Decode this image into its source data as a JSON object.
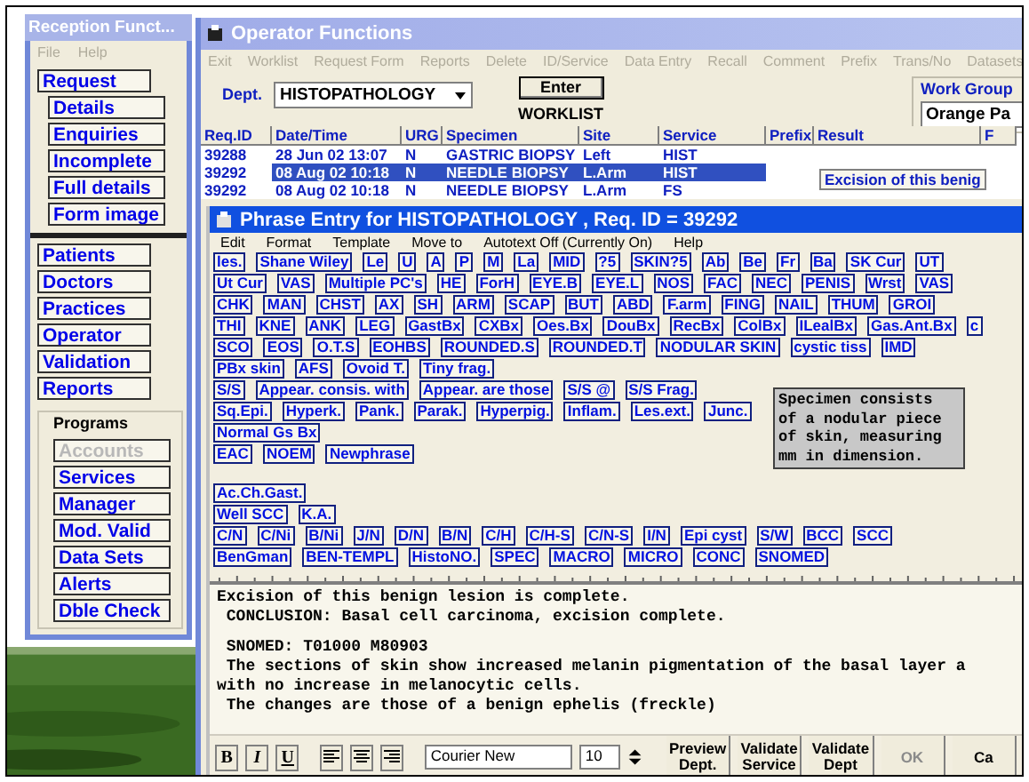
{
  "reception": {
    "title": "Reception Funct...",
    "menu": [
      "File",
      "Help"
    ],
    "nav_groups": [
      {
        "items": [
          {
            "label": "Request",
            "kind": "main"
          },
          {
            "label": "Details",
            "kind": "sub"
          },
          {
            "label": "Enquiries",
            "kind": "sub"
          },
          {
            "label": "Incomplete",
            "kind": "sub"
          },
          {
            "label": "Full details",
            "kind": "sub"
          },
          {
            "label": "Form image",
            "kind": "sub"
          }
        ]
      },
      {
        "items": [
          {
            "label": "Patients",
            "kind": "main"
          },
          {
            "label": "Doctors",
            "kind": "main"
          },
          {
            "label": "Practices",
            "kind": "main"
          },
          {
            "label": "Operator",
            "kind": "main"
          },
          {
            "label": "Validation",
            "kind": "main"
          },
          {
            "label": "Reports",
            "kind": "main"
          }
        ]
      },
      {
        "title": "Programs",
        "items": [
          {
            "label": "Accounts",
            "kind": "sub",
            "disabled": true
          },
          {
            "label": "Services",
            "kind": "sub",
            "disabled": false
          },
          {
            "label": "Manager",
            "kind": "sub",
            "disabled": false
          },
          {
            "label": "Mod. Valid",
            "kind": "sub",
            "disabled": false
          },
          {
            "label": "Data Sets",
            "kind": "sub",
            "disabled": false
          },
          {
            "label": "Alerts",
            "kind": "sub",
            "disabled": false
          },
          {
            "label": "Dble Check",
            "kind": "sub",
            "disabled": false
          }
        ]
      }
    ]
  },
  "operator": {
    "title": "Operator Functions",
    "menu": [
      "Exit",
      "Worklist",
      "Request Form",
      "Reports",
      "Delete",
      "ID/Service",
      "Data Entry",
      "Recall",
      "Comment",
      "Prefix",
      "Trans/No",
      "Datasets"
    ],
    "dept_label": "Dept.",
    "dept_value": "HISTOPATHOLOGY",
    "enter_button": "Enter",
    "worklist_label": "WORKLIST",
    "work_group_label": "Work Group",
    "work_group_value": "Orange Pa",
    "table": {
      "columns": [
        "Req.ID",
        "Date/Time",
        "URG",
        "Specimen",
        "Site",
        "Service",
        "Prefix",
        "Result",
        "F"
      ],
      "rows": [
        {
          "cells": [
            "39288",
            "28 Jun 02 13:07",
            "N",
            "GASTRIC BIOPSY",
            "Left",
            "HIST"
          ],
          "selected": false
        },
        {
          "cells": [
            "39292",
            "08 Aug 02 10:18",
            "N",
            "NEEDLE BIOPSY",
            "L.Arm",
            "HIST"
          ],
          "selected": true,
          "result": "Excision of this benig"
        },
        {
          "cells": [
            "39292",
            "08 Aug 02 10:18",
            "N",
            "NEEDLE BIOPSY",
            "L.Arm",
            "FS"
          ],
          "selected": false
        }
      ]
    }
  },
  "phrase_entry": {
    "title": "Phrase Entry for HISTOPATHOLOGY , Req. ID = 39292",
    "menu": [
      "Edit",
      "Format",
      "Template",
      "Move to",
      "Autotext Off (Currently On)",
      "Help"
    ],
    "phrase_groups": [
      [
        [
          "les.",
          "Shane Wiley",
          "Le",
          "U",
          "A",
          "P",
          "M",
          "La",
          "MID",
          "?5",
          "SKIN?5",
          "Ab",
          "Be",
          "Fr",
          "Ba",
          "SK Cur",
          "UT"
        ],
        [
          "Ut Cur",
          "VAS",
          "Multiple PC's",
          "HE",
          "ForH",
          "EYE.B",
          "EYE.L",
          "NOS",
          "FAC",
          "NEC",
          "PENIS",
          "Wrst",
          "VAS"
        ],
        [
          "CHK",
          "MAN",
          "CHST",
          "AX",
          "SH",
          "ARM",
          "SCAP",
          "BUT",
          "ABD",
          "F.arm",
          "FING",
          "NAIL",
          "THUM",
          "GROI"
        ],
        [
          "THI",
          "KNE",
          "ANK",
          "LEG",
          "GastBx",
          "CXBx",
          "Oes.Bx",
          "DouBx",
          "RecBx",
          "ColBx",
          "ILealBx",
          "Gas.Ant.Bx",
          "c"
        ],
        [
          "SCO",
          "EOS",
          "O.T.S",
          "EOHBS",
          "ROUNDED.S",
          "ROUNDED.T",
          "NODULAR SKIN",
          "cystic tiss",
          "IMD"
        ],
        [
          "PBx skin",
          "AFS",
          "Ovoid T.",
          "Tiny frag."
        ],
        [
          "S/S",
          "Appear. consis. with",
          "Appear. are those",
          "S/S @",
          "S/S Frag."
        ],
        [
          "Sq.Epi.",
          "Hyperk.",
          "Pank.",
          "Parak.",
          "Hyperpig.",
          "Inflam.",
          "Les.ext.",
          "Junc."
        ],
        [
          "Normal Gs Bx"
        ],
        [
          "EAC",
          "NOEM",
          "Newphrase"
        ]
      ],
      [
        [
          "Ac.Ch.Gast."
        ],
        [
          "Well SCC",
          "K.A."
        ],
        [
          "C/N",
          "C/Ni",
          "B/Ni",
          "J/N",
          "D/N",
          "B/N",
          "C/H",
          "C/H-S",
          "C/N-S",
          "I/N",
          "Epi cyst",
          "S/W",
          "BCC",
          "SCC"
        ],
        [
          "BenGman",
          "BEN-TEMPL",
          "HistoNO.",
          "SPEC",
          "MACRO",
          "MICRO",
          "CONC",
          "SNOMED"
        ]
      ]
    ],
    "tooltip": "Specimen consists of a nodular piece of skin, measuring mm in dimension.",
    "report_paragraphs": [
      [
        "Excision of this benign lesion is complete.",
        " CONCLUSION: Basal cell carcinoma, excision complete."
      ],
      [
        " SNOMED: T01000 M80903",
        " The sections of skin show increased melanin pigmentation of the basal layer a",
        "with no increase in melanocytic cells.",
        " The changes are those of a benign ephelis (freckle)"
      ]
    ],
    "format_buttons": [
      "B",
      "I",
      "U"
    ],
    "font_name": "Courier New",
    "font_size": "10",
    "action_buttons": [
      {
        "label": "Preview Dept.",
        "disabled": false
      },
      {
        "label": "Validate Service",
        "disabled": false
      },
      {
        "label": "Validate Dept",
        "disabled": false
      },
      {
        "label": "OK",
        "disabled": true
      },
      {
        "label": "Ca",
        "disabled": false
      }
    ]
  }
}
